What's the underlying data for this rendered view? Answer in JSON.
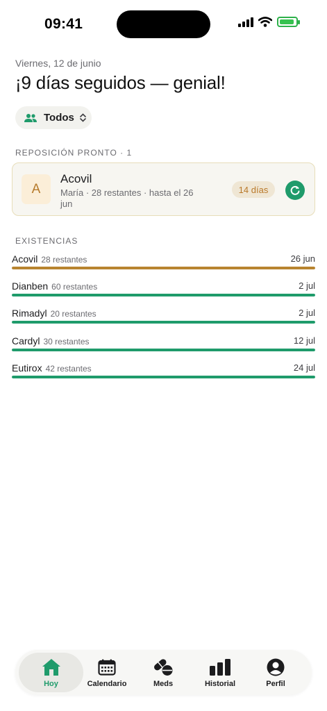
{
  "status_bar": {
    "time": "09:41",
    "battery_level": 0.92,
    "battery_color": "#36c24f"
  },
  "header": {
    "date": "Viernes, 12 de junio",
    "title": "¡9 días seguidos — genial!"
  },
  "filter": {
    "label": "Todos",
    "icon": "people-icon"
  },
  "refill_section": {
    "label": "REPOSICIÓN PRONTO",
    "count": "1",
    "card": {
      "initial": "A",
      "name": "Acovil",
      "meta": "María · 28 restantes · hasta el 26 jun",
      "days": "14 días",
      "button_icon": "refresh-icon"
    }
  },
  "stock_section": {
    "label": "EXISTENCIAS",
    "items": [
      {
        "name": "Acovil",
        "count": "28 restantes",
        "date": "26 jun",
        "level": 1.0,
        "color": "#b8842f"
      },
      {
        "name": "Dianben",
        "count": "60 restantes",
        "date": "2 jul",
        "level": 1.0,
        "color": "#1f9b6b"
      },
      {
        "name": "Rimadyl",
        "count": "20 restantes",
        "date": "2 jul",
        "level": 1.0,
        "color": "#1f9b6b"
      },
      {
        "name": "Cardyl",
        "count": "30 restantes",
        "date": "12 jul",
        "level": 1.0,
        "color": "#1f9b6b"
      },
      {
        "name": "Eutirox",
        "count": "42 restantes",
        "date": "24 jul",
        "level": 1.0,
        "color": "#1f9b6b"
      }
    ]
  },
  "tabs": [
    {
      "label": "Hoy",
      "icon": "home-icon",
      "active": true
    },
    {
      "label": "Calendario",
      "icon": "calendar-icon",
      "active": false
    },
    {
      "label": "Meds",
      "icon": "pills-icon",
      "active": false
    },
    {
      "label": "Historial",
      "icon": "bar-chart-icon",
      "active": false
    },
    {
      "label": "Perfil",
      "icon": "profile-icon",
      "active": false
    }
  ],
  "colors": {
    "accent": "#1f9b6b",
    "warning": "#b8842f",
    "badge_bg": "#efe6d4"
  }
}
